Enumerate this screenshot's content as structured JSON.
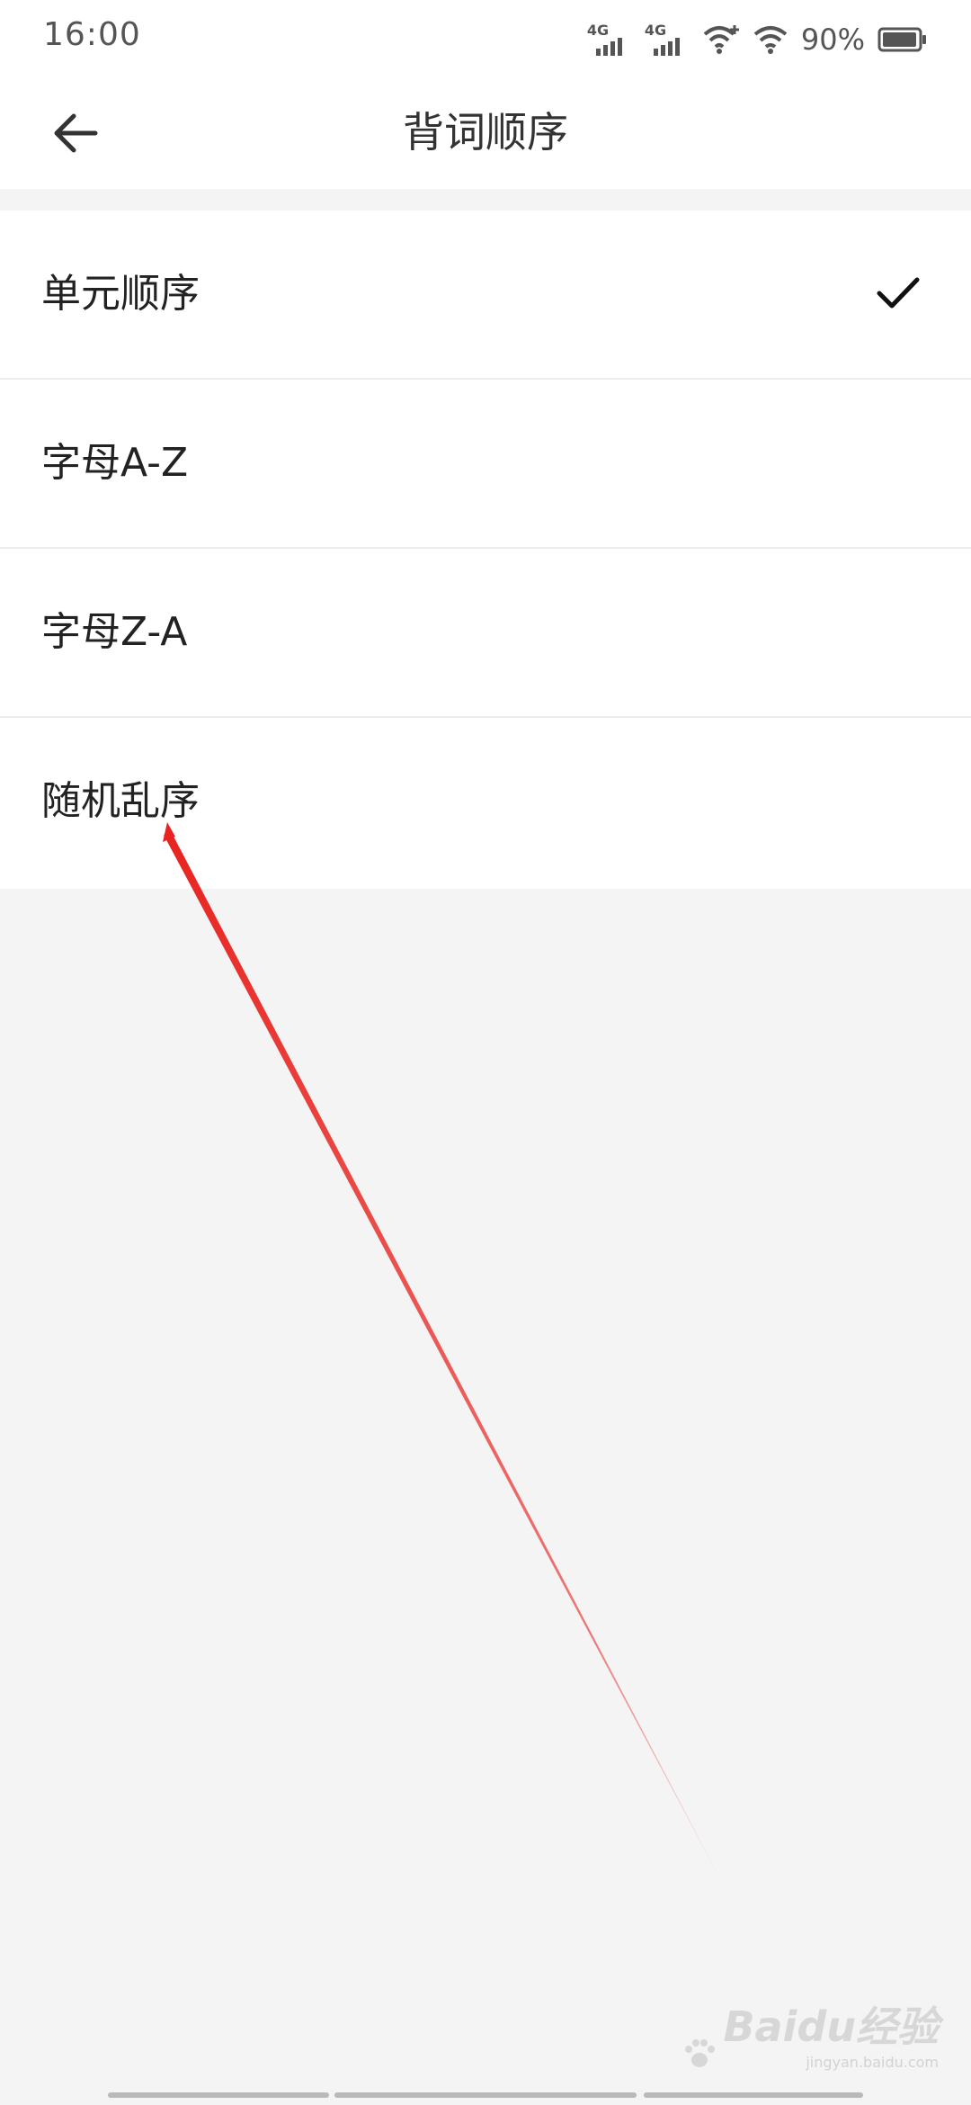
{
  "status_bar": {
    "time": "16:00",
    "network_1": "4G",
    "network_2": "4G",
    "battery_percent": "90%"
  },
  "header": {
    "title": "背词顺序"
  },
  "options": [
    {
      "label": "单元顺序",
      "selected": true
    },
    {
      "label": "字母A-Z",
      "selected": false
    },
    {
      "label": "字母Z-A",
      "selected": false
    },
    {
      "label": "随机乱序",
      "selected": false
    }
  ],
  "watermark": {
    "text": "Baidu经验",
    "url": "jingyan.baidu.com"
  },
  "colors": {
    "background": "#f4f4f4",
    "surface": "#ffffff",
    "annotation": "#e8231f"
  },
  "icons": {
    "back": "arrow-left-icon",
    "selected": "check-icon",
    "signal": "signal-icon",
    "wifi": "wifi-icon",
    "battery": "battery-icon"
  }
}
